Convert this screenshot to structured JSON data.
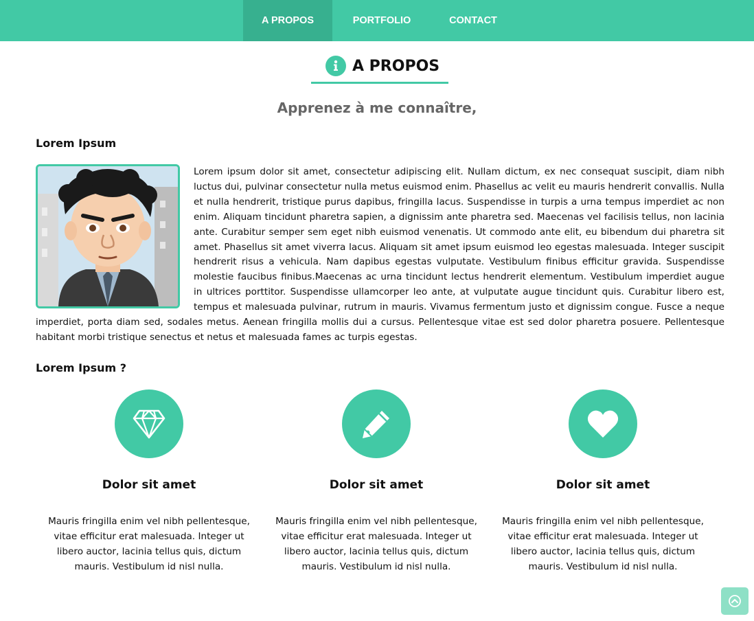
{
  "nav": {
    "items": [
      {
        "label": "A PROPOS",
        "active": true
      },
      {
        "label": "PORTFOLIO",
        "active": false
      },
      {
        "label": "CONTACT",
        "active": false
      }
    ]
  },
  "section": {
    "title": "A PROPOS",
    "icon": "info-icon",
    "subtitle": "Apprenez à me connaître,"
  },
  "about": {
    "heading": "Lorem Ipsum",
    "avatar": "cartoon-avatar",
    "text": "Lorem ipsum dolor sit amet, consectetur adipiscing elit. Nullam dictum, ex nec consequat suscipit, diam nibh luctus dui, pulvinar consectetur nulla metus euismod enim. Phasellus ac velit eu mauris hendrerit convallis. Nulla et nulla hendrerit, tristique purus dapibus, fringilla lacus. Suspendisse in turpis a urna tempus imperdiet ac non enim. Aliquam tincidunt pharetra sapien, a dignissim ante pharetra sed. Maecenas vel facilisis tellus, non lacinia ante. Curabitur semper sem eget nibh euismod venenatis. Ut commodo ante elit, eu bibendum dui pharetra sit amet. Phasellus sit amet viverra lacus. Aliquam sit amet ipsum euismod leo egestas malesuada. Integer suscipit hendrerit risus a vehicula. Nam dapibus egestas vulputate. Vestibulum finibus efficitur gravida. Suspendisse molestie faucibus finibus.Maecenas ac urna tincidunt lectus hendrerit elementum. Vestibulum imperdiet augue in ultrices porttitor. Suspendisse ullamcorper leo ante, at vulputate augue tincidunt quis. Curabitur libero est, tempus et malesuada pulvinar, rutrum in mauris. Vivamus fermentum justo et dignissim congue. Fusce a neque imperdiet, porta diam sed, sodales metus. Aenean fringilla mollis dui a cursus. Pellentesque vitae est sed dolor pharetra posuere. Pellentesque habitant morbi tristique senectus et netus et malesuada fames ac turpis egestas."
  },
  "features": {
    "heading": "Lorem Ipsum ?",
    "items": [
      {
        "icon": "diamond-icon",
        "title": "Dolor sit amet",
        "text": "Mauris fringilla enim vel nibh pellentesque, vitae efficitur erat malesuada. Integer ut libero auctor, lacinia tellus quis, dictum mauris. Vestibulum id nisl nulla."
      },
      {
        "icon": "pencil-icon",
        "title": "Dolor sit amet",
        "text": "Mauris fringilla enim vel nibh pellentesque, vitae efficitur erat malesuada. Integer ut libero auctor, lacinia tellus quis, dictum mauris. Vestibulum id nisl nulla."
      },
      {
        "icon": "heart-icon",
        "title": "Dolor sit amet",
        "text": "Mauris fringilla enim vel nibh pellentesque, vitae efficitur erat malesuada. Integer ut libero auctor, lacinia tellus quis, dictum mauris. Vestibulum id nisl nulla."
      }
    ]
  },
  "scroll_top": {
    "icon": "chevron-up-icon"
  },
  "colors": {
    "accent": "#42c9a5",
    "accent_dark": "#37b08f",
    "subtitle": "#666666",
    "scroll_top": "#8ee0c6"
  }
}
